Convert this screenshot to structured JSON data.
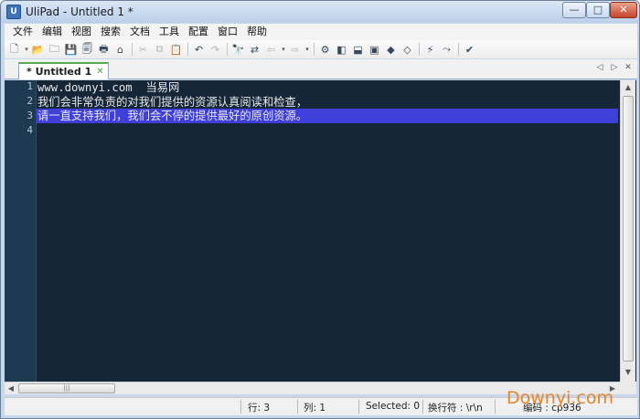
{
  "window": {
    "title": "UliPad - Untitled 1 *",
    "icon_text": "U"
  },
  "window_controls": {
    "minimize": "—",
    "maximize": "□",
    "close": "✕"
  },
  "menu": [
    "文件",
    "编辑",
    "视图",
    "搜索",
    "文档",
    "工具",
    "配置",
    "窗口",
    "帮助"
  ],
  "toolbar": {
    "glyphs": {
      "new": "🗋",
      "new_dropdown": "▾",
      "open": "📂",
      "open_folder": "🗀",
      "save": "💾",
      "save_all": "🗐",
      "print": "🖶",
      "web": "⌂",
      "cut": "✂",
      "copy": "⧉",
      "paste": "📋",
      "undo": "↶",
      "redo": "↷",
      "find": "🔭",
      "replace": "⇄",
      "back": "⇦",
      "back_dropdown": "▾",
      "forward": "⇨",
      "forward_dropdown": "▾",
      "pref": "⚙",
      "panel_left": "◧",
      "panel_bottom": "⬓",
      "shell": "▣",
      "bookmark": "◆",
      "bookmark2": "◇",
      "run": "⚡",
      "debug": "⤳",
      "spell": "✔"
    }
  },
  "tabs": {
    "active_label": "* Untitled 1",
    "close_glyph": "✕",
    "nav_left": "◁",
    "nav_right": "▷",
    "nav_close": "✕"
  },
  "editor": {
    "line_numbers": [
      "1",
      "2",
      "3",
      "4"
    ],
    "lines": [
      "www.downyi.com  当易网",
      "我们会非常负责的对我们提供的资源认真阅读和检查，",
      "请一直支持我们，我们会不停的提供最好的原创资源。",
      ""
    ],
    "current_line": 3
  },
  "scrollbars": {
    "up": "▲",
    "down": "▼",
    "left": "◀",
    "right": "▶",
    "grip": "|||"
  },
  "status": {
    "row": "行: 3",
    "col": "列: 1",
    "selected": "Selected: 0",
    "eol": "换行符 : \\r\\n",
    "encoding": "编码 : cp936"
  },
  "watermark": "Downyi.com"
}
